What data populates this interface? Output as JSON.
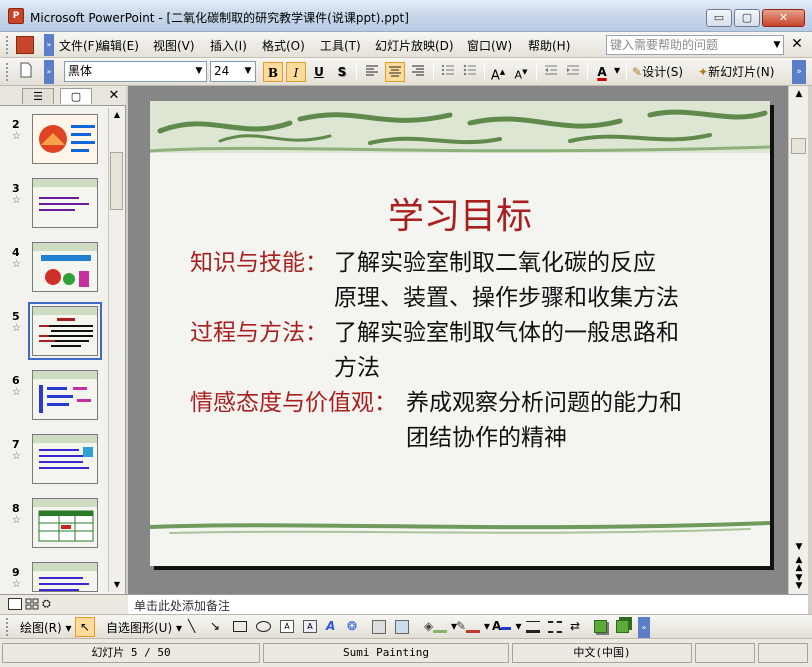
{
  "window": {
    "title": "Microsoft PowerPoint - [二氧化碳制取的研究教学课件(说课ppt).ppt]",
    "icon_label": "P",
    "minimize_label": "▭",
    "maximize_label": "▢",
    "close_label": "✕"
  },
  "menu": {
    "items": [
      {
        "label": "文件(F)"
      },
      {
        "label": "编辑(E)"
      },
      {
        "label": "视图(V)"
      },
      {
        "label": "插入(I)"
      },
      {
        "label": "格式(O)"
      },
      {
        "label": "工具(T)"
      },
      {
        "label": "幻灯片放映(D)"
      },
      {
        "label": "窗口(W)"
      },
      {
        "label": "帮助(H)"
      }
    ],
    "help_placeholder": "键入需要帮助的问题",
    "close_doc": "✕"
  },
  "toolbar": {
    "font": "黑体",
    "size": "24",
    "bold": "B",
    "italic": "I",
    "underline": "U",
    "shadow": "S",
    "font_color": "A",
    "design_label": "设计(S)",
    "new_slide_label": "新幻灯片(N)"
  },
  "slides_panel": {
    "thumbnails": [
      {
        "num": "2",
        "star": "☆"
      },
      {
        "num": "3",
        "star": "☆"
      },
      {
        "num": "4",
        "star": "☆"
      },
      {
        "num": "5",
        "star": "☆"
      },
      {
        "num": "6",
        "star": "☆"
      },
      {
        "num": "7",
        "star": "☆"
      },
      {
        "num": "8",
        "star": "☆"
      },
      {
        "num": "9",
        "star": "☆"
      }
    ],
    "close": "✕",
    "selected": "5"
  },
  "slide": {
    "title": "学习目标",
    "lines": [
      {
        "label": "知识与技能：",
        "text": "了解实验室制取二氧化碳的反应"
      },
      {
        "label": "",
        "text": "原理、装置、操作步骤和收集方法"
      },
      {
        "label": "过程与方法：",
        "text": "了解实验室制取气体的一般思路和"
      },
      {
        "label": "",
        "text": "方法"
      },
      {
        "label": "情感态度与价值观：",
        "text": "养成观察分析问题的能力和"
      },
      {
        "label": "",
        "text": "团结协作的精神"
      }
    ]
  },
  "notes": {
    "placeholder": "单击此处添加备注"
  },
  "drawing_toolbar": {
    "draw_label": "绘图(R)",
    "autoshapes_label": "自选图形(U)"
  },
  "status": {
    "slide_pos": "幻灯片 5 / 50",
    "design": "Sumi Painting",
    "language": "中文(中国)"
  },
  "colors": {
    "slide_title": "#a91f1f",
    "label_red": "#a91f1f",
    "selection_blue": "#3d6bc6"
  }
}
